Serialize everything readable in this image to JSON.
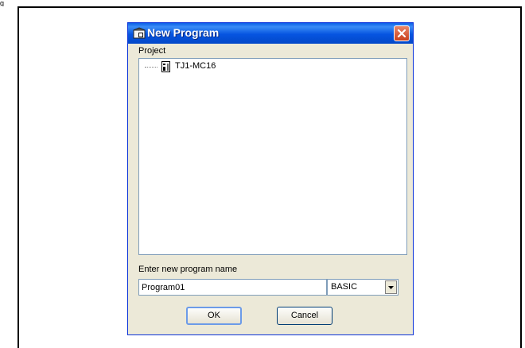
{
  "page_corner_text": "g",
  "dialog": {
    "title": "New Program",
    "project_label": "Project",
    "tree": [
      {
        "label": "TJ1-MC16"
      }
    ],
    "name_label": "Enter new program name",
    "name_value": "Program01",
    "type_select": {
      "value": "BASIC"
    },
    "ok_label": "OK",
    "cancel_label": "Cancel"
  },
  "colors": {
    "titlebar": "#0654e0",
    "dialog_bg": "#ece9d8",
    "close_button": "#c9401c",
    "field_border": "#7f9db9"
  },
  "icons": [
    "window-app-icon",
    "close-icon",
    "controller-icon",
    "dropdown-arrow-icon"
  ]
}
